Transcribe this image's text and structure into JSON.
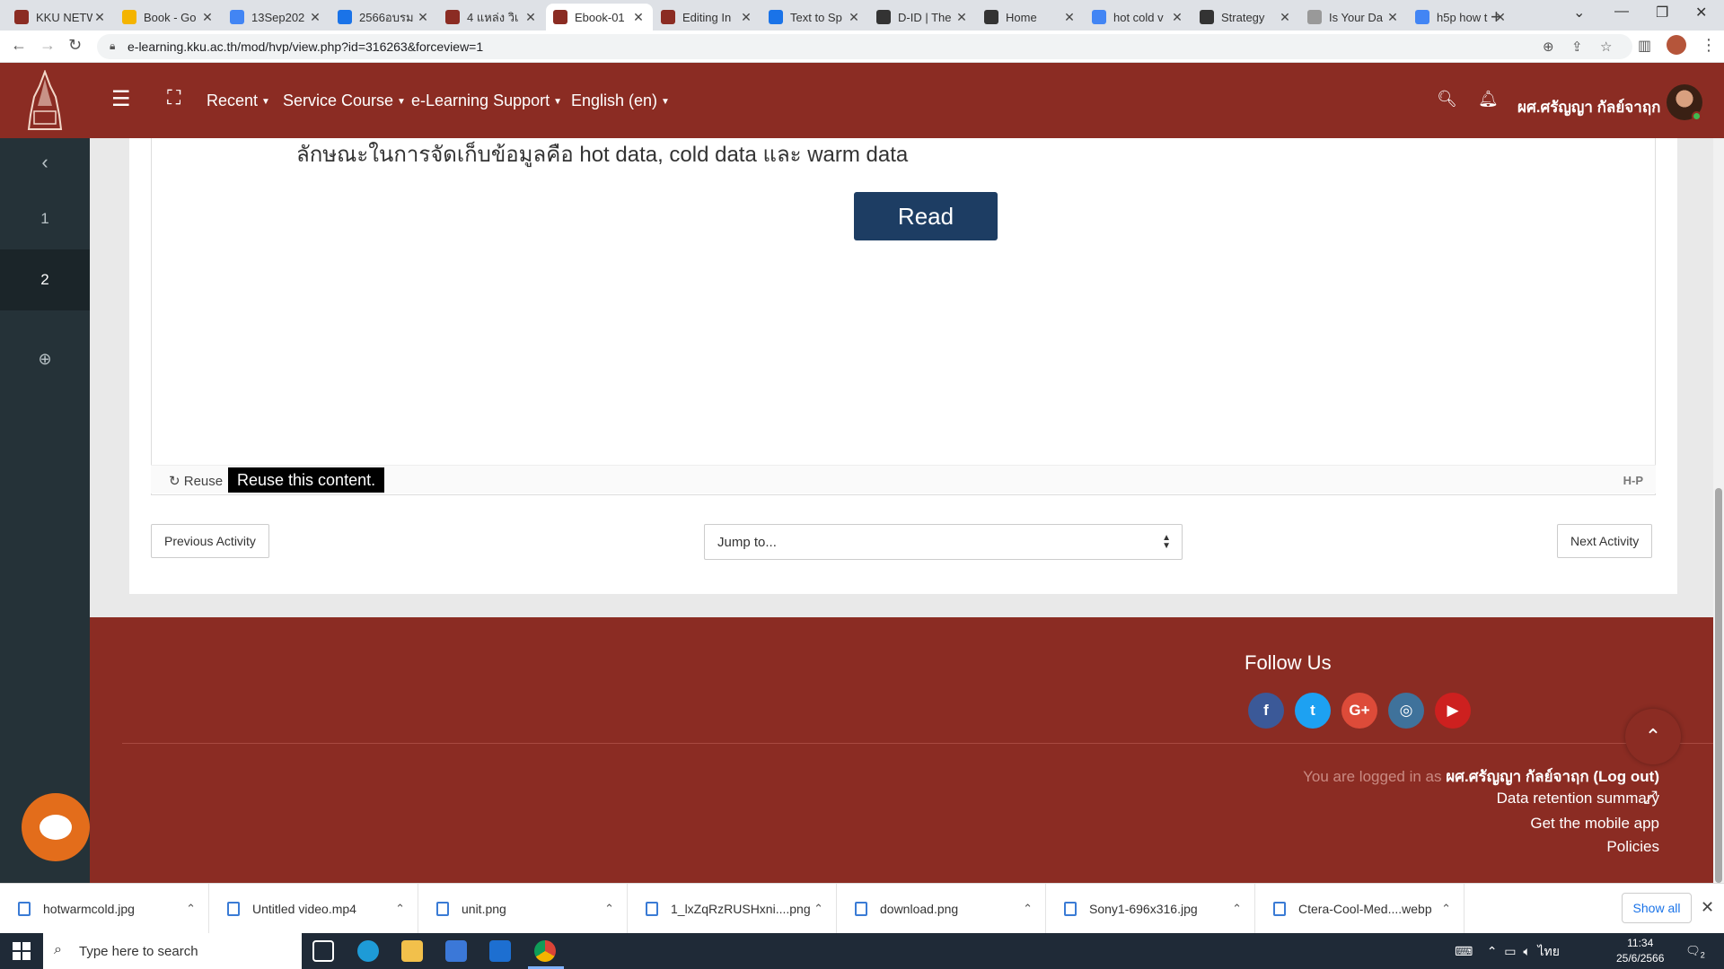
{
  "browser": {
    "tabs": [
      {
        "title": "KKU NETW",
        "icon": "kku-icon",
        "color": "#8b2c23"
      },
      {
        "title": "Book - Go",
        "icon": "google-drive-icon",
        "color": "#f4b400"
      },
      {
        "title": "13Sep202",
        "icon": "google-docs-icon",
        "color": "#4285f4"
      },
      {
        "title": "2566อบรม",
        "icon": "google-slides-icon",
        "color": "#1a73e8"
      },
      {
        "title": "4 แหล่ง วิเ",
        "icon": "kku-icon",
        "color": "#8b2c23"
      },
      {
        "title": "Ebook-01",
        "icon": "kku-icon",
        "color": "#8b2c23",
        "active": true
      },
      {
        "title": "Editing In",
        "icon": "kku-icon",
        "color": "#8b2c23"
      },
      {
        "title": "Text to Sp",
        "icon": "globe-icon",
        "color": "#1a73e8"
      },
      {
        "title": "D-ID | The",
        "icon": "did-icon",
        "color": "#333333"
      },
      {
        "title": "Home",
        "icon": "did-icon",
        "color": "#333333"
      },
      {
        "title": "hot cold v",
        "icon": "google-icon",
        "color": "#4285f4"
      },
      {
        "title": "Strategy",
        "icon": "github-icon",
        "color": "#333333"
      },
      {
        "title": "Is Your Da",
        "icon": "page-icon",
        "color": "#999999"
      },
      {
        "title": "h5p how t",
        "icon": "google-icon",
        "color": "#4285f4"
      }
    ],
    "url": "e-learning.kku.ac.th/mod/hvp/view.php?id=316263&forceview=1"
  },
  "header": {
    "menus": [
      {
        "label": "Recent"
      },
      {
        "label": "Service Course"
      },
      {
        "label": "e-Learning Support"
      },
      {
        "label": "English (en)"
      }
    ],
    "user_name": "ผศ.ศรัญญา กัลย์จาฤก"
  },
  "drawer": {
    "items": [
      "1",
      "2"
    ]
  },
  "content": {
    "thai_text": "ลักษณะในการจัดเก็บข้อมูลคือ hot data, cold data และ warm data",
    "read_button": "Read",
    "reuse_label": "Reuse",
    "reuse_tooltip": "Reuse this content.",
    "h5p_logo": "H-P",
    "prev_activity": "Previous Activity",
    "jump_to": "Jump to...",
    "next_activity": "Next Activity"
  },
  "footer": {
    "follow_us": "Follow Us",
    "social": [
      {
        "icon": "facebook-icon",
        "glyph": "f",
        "color": "#3b5998"
      },
      {
        "icon": "twitter-icon",
        "glyph": "t",
        "color": "#1da1f2"
      },
      {
        "icon": "google-plus-icon",
        "glyph": "G+",
        "color": "#dd4b39"
      },
      {
        "icon": "instagram-icon",
        "glyph": "◎",
        "color": "#3f729b"
      },
      {
        "icon": "youtube-icon",
        "glyph": "▶",
        "color": "#cd201f"
      }
    ],
    "logged_in_prefix": "You are logged in as",
    "logged_in_user": "ผศ.ศรัญญา กัลย์จาฤก",
    "logout": "(Log out)",
    "data_retention": "Data retention summary",
    "mobile_app": "Get the mobile app",
    "policies": "Policies"
  },
  "downloads": {
    "items": [
      "hotwarmcold.jpg",
      "Untitled video.mp4",
      "unit.png",
      "1_lxZqRzRUSHxni....png",
      "download.png",
      "Sony1-696x316.jpg",
      "Ctera-Cool-Med....webp"
    ],
    "show_all": "Show all"
  },
  "taskbar": {
    "search_placeholder": "Type here to search",
    "time": "11:34",
    "date": "25/6/2566",
    "lang": "ไทย",
    "notif_count": "2"
  }
}
